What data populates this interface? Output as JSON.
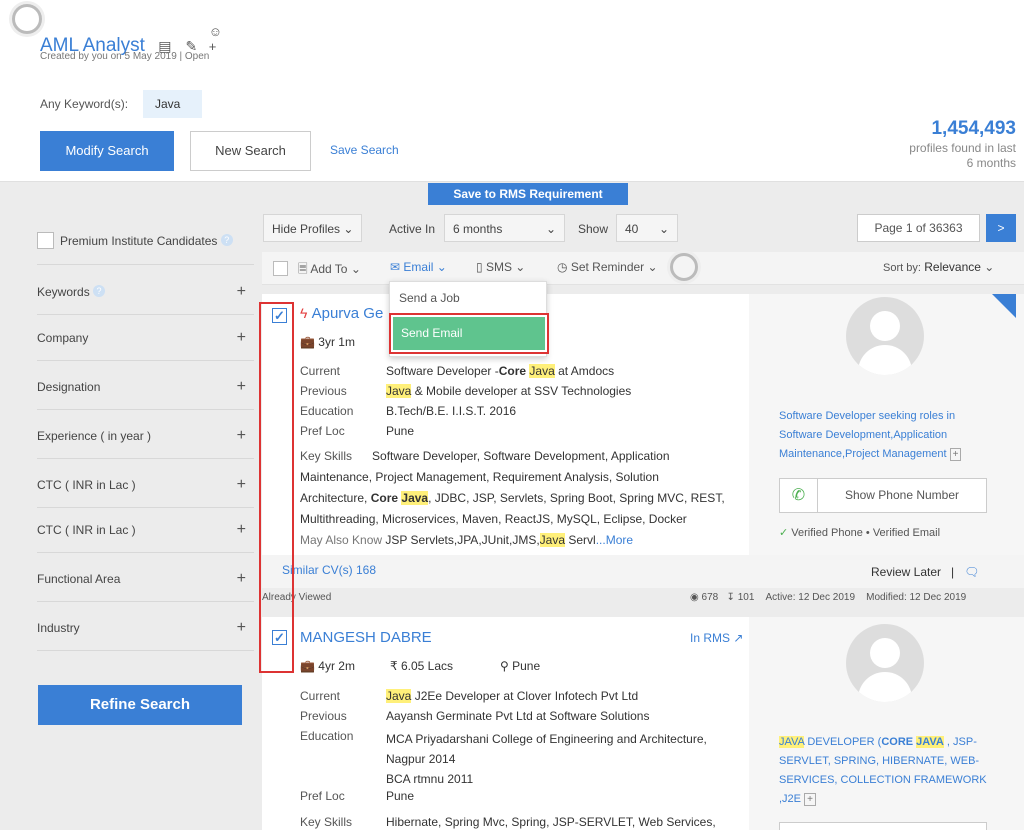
{
  "header": {
    "title": "AML Analyst",
    "subtitle": "Created by you on 5 May 2019  |  Open",
    "keyword_label": "Any Keyword(s):",
    "keyword_value": "Java",
    "modify_search": "Modify Search",
    "new_search": "New Search",
    "save_search": "Save Search",
    "count": "1,454,493",
    "count_label": "profiles found in last 6 months"
  },
  "save_rms": "Save to RMS Requirement",
  "sidebar": {
    "premium": "Premium Institute Candidates",
    "filters": [
      {
        "label": "Keywords"
      },
      {
        "label": "Company"
      },
      {
        "label": "Designation"
      },
      {
        "label": "Experience ( in year )"
      },
      {
        "label": "CTC ( INR in Lac )"
      },
      {
        "label": "CTC ( INR in Lac )"
      },
      {
        "label": "Functional Area"
      },
      {
        "label": "Industry"
      }
    ],
    "refine": "Refine Search"
  },
  "toolbar": {
    "hide_profiles": "Hide Profiles",
    "active_in_label": "Active In",
    "active_in_value": "6 months",
    "show_label": "Show",
    "show_value": "40",
    "page": "Page 1 of 36363",
    "next": ">",
    "add_to": "Add To",
    "email": "Email",
    "sms": "SMS",
    "set_reminder": "Set Reminder",
    "sort_by_label": "Sort by:",
    "sort_by_value": "Relevance"
  },
  "dropdown": {
    "send_job": "Send a Job",
    "send_email": "Send Email"
  },
  "card1": {
    "name": "Apurva Ge",
    "exp": "3yr 1m",
    "current_label": "Current",
    "current_pre": "Software Developer -",
    "current_bold": "Core ",
    "current_hl": "Java",
    "current_post": " at Amdocs",
    "previous_label": "Previous",
    "previous_hl": "Java",
    "previous_post": " & Mobile developer at SSV Technologies",
    "education_label": "Education",
    "education": "B.Tech/B.E. I.I.S.T. 2016",
    "prefloc_label": "Pref Loc",
    "prefloc": "Pune",
    "keyskills_label": "Key Skills",
    "ks1": "Software Developer, Software Development, Application",
    "ks2": "Maintenance, Project Management, Requirement Analysis, Solution",
    "ks3_pre": "Architecture, ",
    "ks3_bold": "Core ",
    "ks3_hl": "Java",
    "ks3_post": ", JDBC, JSP, Servlets, Spring Boot, Spring MVC, REST,",
    "ks4": "Multithreading, Microservices, Maven, ReactJS, MySQL, Eclipse, Docker",
    "may_label": "May Also Know",
    "may_pre": "JSP Servlets,JPA,JUnit,JMS,",
    "may_hl": "Java",
    "may_post": " Servl",
    "more": "...More",
    "headline": "Software Developer seeking roles in Software Development,Application Maintenance,Project Management",
    "show_phone": "Show Phone Number",
    "verified_phone": "Verified Phone",
    "verified_email": "Verified Email",
    "similar": "Similar CV(s) 168",
    "review_later": "Review Later",
    "already_viewed": "Already Viewed",
    "views": "678",
    "downloads": "101",
    "active": "Active: 12 Dec 2019",
    "modified": "Modified: 12 Dec 2019"
  },
  "card2": {
    "name": "MANGESH DABRE",
    "in_rms": "In RMS",
    "exp": "4yr 2m",
    "ctc": "₹ 6.05 Lacs",
    "loc": "Pune",
    "current_label": "Current",
    "current_hl": "Java",
    "current_post": " J2Ee Developer at Clover Infotech Pvt Ltd",
    "previous_label": "Previous",
    "previous": "Aayansh Germinate Pvt Ltd at Software Solutions",
    "education_label": "Education",
    "education1": "MCA Priyadarshani College of Engineering and Architecture,",
    "education2": "Nagpur 2014",
    "education3": "BCA rtmnu 2011",
    "prefloc_label": "Pref Loc",
    "prefloc": "Pune",
    "keyskills_label": "Key Skills",
    "keyskills": "Hibernate, Spring Mvc, Spring, JSP-SERVLET, Web Services,",
    "hl_java1": "JAVA",
    "head_a": " DEVELOPER (",
    "head_core": "CORE ",
    "hl_java2": "JAVA",
    "head_b": " , JSP-",
    "head_c": "SERVLET, SPRING, HIBERNATE, WEB-",
    "head_d": "SERVICES, COLLECTION FRAMEWORK",
    "head_e": ",J2E"
  },
  "colors": {
    "accent": "#3a7fd5",
    "highlight": "#fff07a",
    "success": "#5fc48e",
    "alert": "#dd3333"
  }
}
